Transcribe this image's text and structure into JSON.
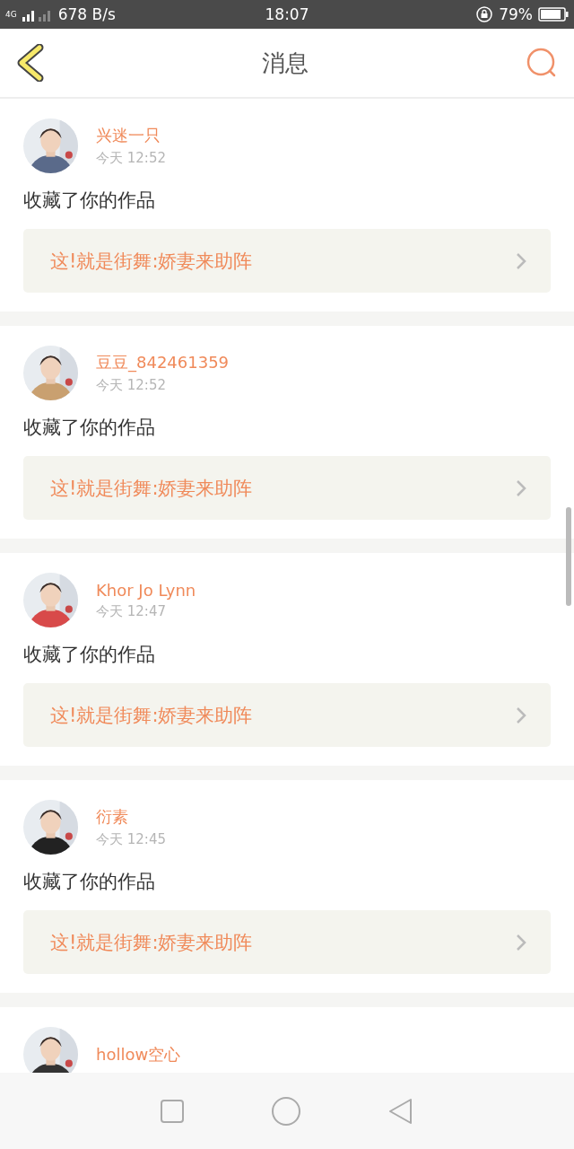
{
  "status_bar": {
    "network": "4G",
    "speed": "678 B/s",
    "time": "18:07",
    "battery": "79%"
  },
  "header": {
    "title": "消息"
  },
  "messages": [
    {
      "user": "兴迷一只",
      "time": "今天  12:52",
      "action": "收藏了你的作品",
      "work": "这!就是街舞:娇妻来助阵"
    },
    {
      "user": "豆豆_842461359",
      "time": "今天  12:52",
      "action": "收藏了你的作品",
      "work": "这!就是街舞:娇妻来助阵"
    },
    {
      "user": "Khor Jo Lynn",
      "time": "今天  12:47",
      "action": "收藏了你的作品",
      "work": "这!就是街舞:娇妻来助阵"
    },
    {
      "user": "衍素",
      "time": "今天  12:45",
      "action": "收藏了你的作品",
      "work": "这!就是街舞:娇妻来助阵"
    },
    {
      "user": "hollow空心"
    }
  ]
}
